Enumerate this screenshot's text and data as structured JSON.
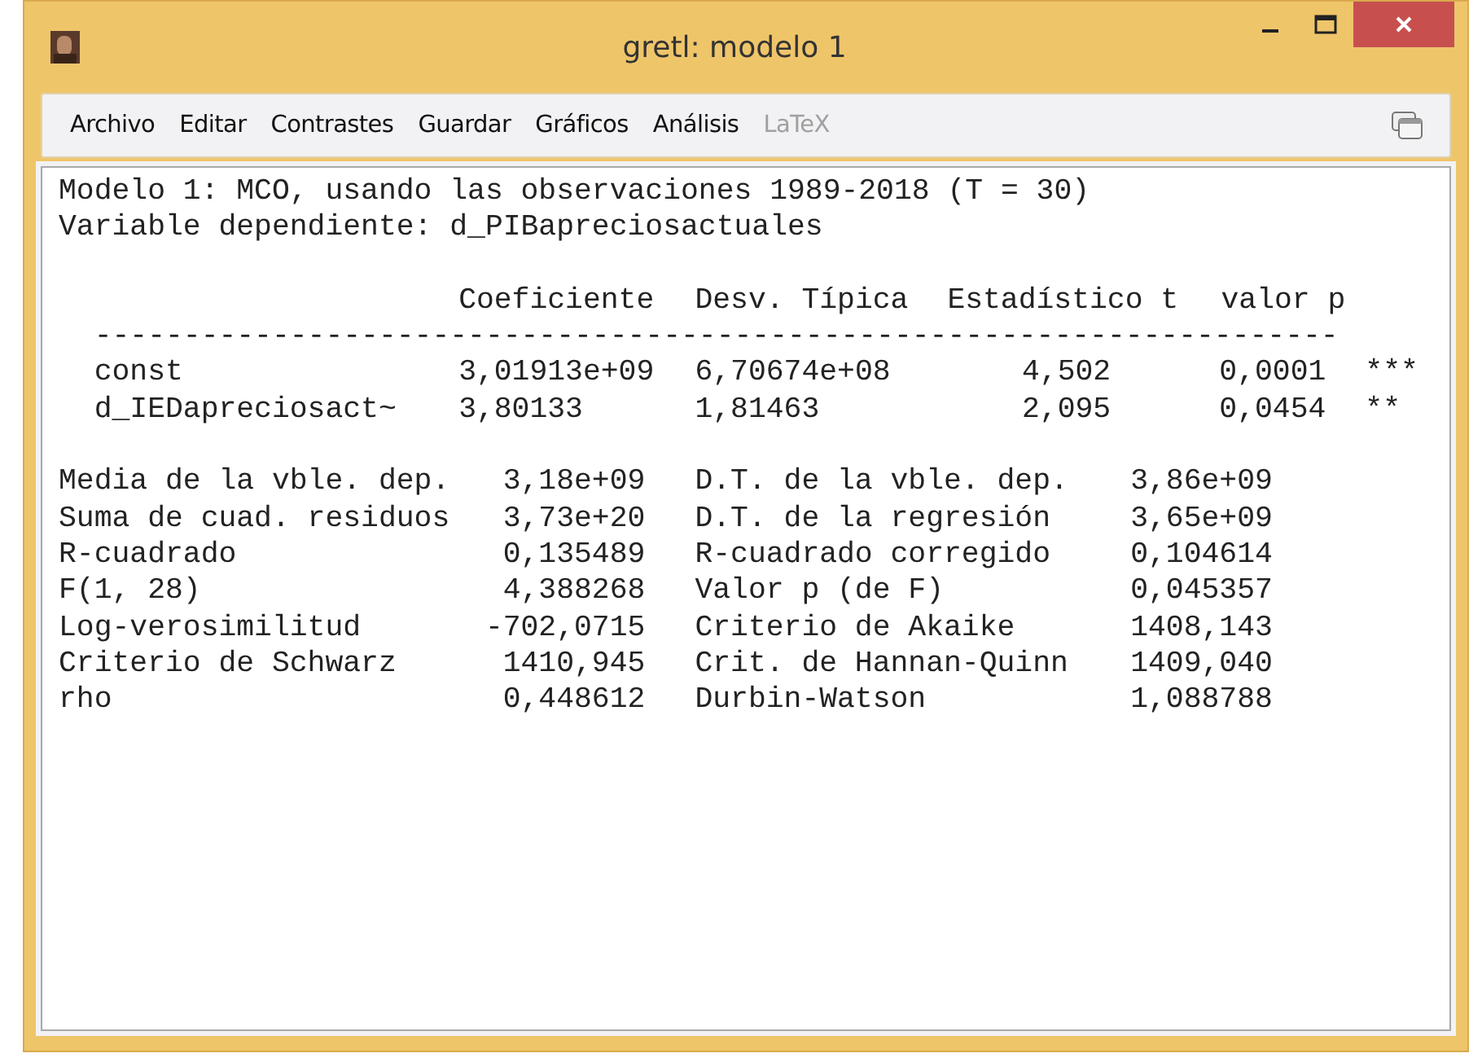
{
  "window": {
    "title": "gretl: modelo 1"
  },
  "menu": [
    {
      "label": "Archivo",
      "disabled": false
    },
    {
      "label": "Editar",
      "disabled": false
    },
    {
      "label": "Contrastes",
      "disabled": false
    },
    {
      "label": "Guardar",
      "disabled": false
    },
    {
      "label": "Gráficos",
      "disabled": false
    },
    {
      "label": "Análisis",
      "disabled": false
    },
    {
      "label": "LaTeX",
      "disabled": true
    }
  ],
  "output": {
    "header_lines": [
      "Modelo 1: MCO, usando las observaciones 1989-2018 (T = 30)",
      "Variable dependiente: d_PIBapreciosactuales"
    ],
    "coef_columns": [
      "Coeficiente",
      "Desv. Típica",
      "Estadístico t",
      "valor p"
    ],
    "separator": "----------------------------------------------------------------------",
    "coef_rows": [
      {
        "name": "const",
        "coef": "3,01913e+09",
        "se": "6,70674e+08",
        "t": "4,502",
        "p": "0,0001",
        "stars": "***"
      },
      {
        "name": "d_IEDapreciosact~",
        "coef": "3,80133",
        "se": "1,81463",
        "t": "2,095",
        "p": "0,0454",
        "stars": "**"
      }
    ],
    "stats": [
      {
        "label": "Media de la vble. dep.",
        "value": "3,18e+09",
        "label2": "D.T. de la vble. dep.",
        "value2": "3,86e+09"
      },
      {
        "label": "Suma de cuad. residuos",
        "value": "3,73e+20",
        "label2": "D.T. de la regresión",
        "value2": "3,65e+09"
      },
      {
        "label": "R-cuadrado",
        "value": "0,135489",
        "label2": "R-cuadrado corregido",
        "value2": "0,104614"
      },
      {
        "label": "F(1, 28)",
        "value": "4,388268",
        "label2": "Valor p (de F)",
        "value2": "0,045357"
      },
      {
        "label": "Log-verosimilitud",
        "value": "-702,0715",
        "label2": "Criterio de Akaike",
        "value2": "1408,143"
      },
      {
        "label": "Criterio de Schwarz",
        "value": "1410,945",
        "label2": "Crit. de Hannan-Quinn",
        "value2": "1409,040"
      },
      {
        "label": "rho",
        "value": "0,448612",
        "label2": "Durbin-Watson",
        "value2": "1,088788"
      }
    ]
  }
}
